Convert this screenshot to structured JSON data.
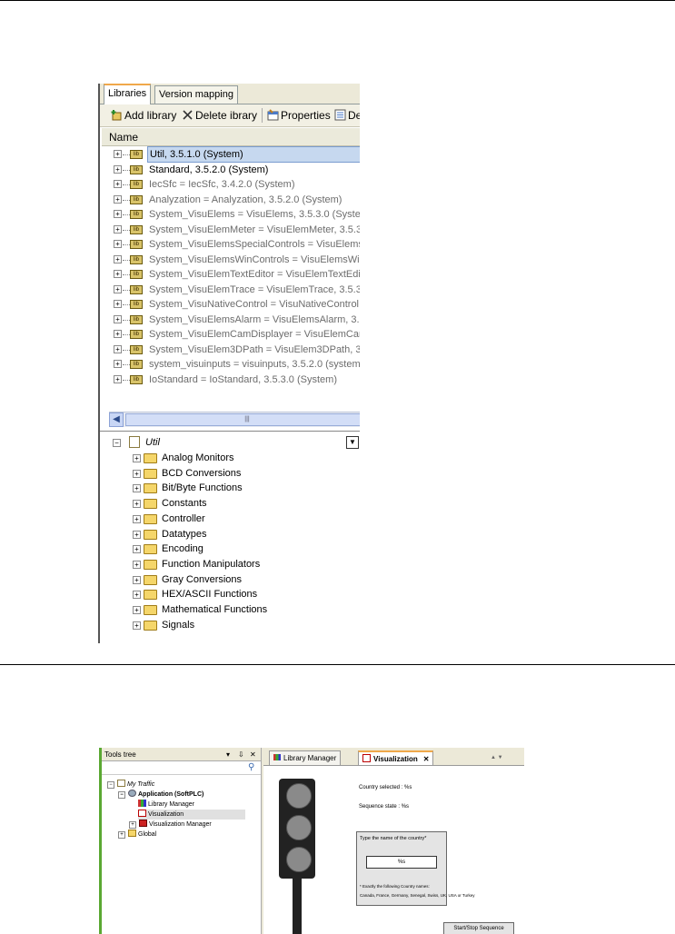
{
  "library_manager": {
    "tabs": [
      "Libraries",
      "Version mapping"
    ],
    "toolbar": {
      "add_library": "Add library",
      "delete_library": "Delete ibrary",
      "properties": "Properties",
      "details": "De"
    },
    "column_header": "Name",
    "libraries": [
      "Util, 3.5.1.0 (System)",
      "Standard, 3.5.2.0 (System)",
      "IecSfc = IecSfc, 3.4.2.0 (System)",
      "Analyzation = Analyzation, 3.5.2.0 (System)",
      "System_VisuElems = VisuElems, 3.5.3.0 (System",
      "System_VisuElemMeter = VisuElemMeter, 3.5.3.0",
      "System_VisuElemsSpecialControls = VisuElemsSp",
      "System_VisuElemsWinControls = VisuElemsWinC",
      "System_VisuElemTextEditor = VisuElemTextEdito",
      "System_VisuElemTrace = VisuElemTrace, 3.5.3.0",
      "System_VisuNativeControl = VisuNativeControl, 3",
      "System_VisuElemsAlarm = VisuElemsAlarm, 3.5.3",
      "System_VisuElemCamDisplayer = VisuElemCamDi",
      "System_VisuElem3DPath = VisuElem3DPath, 3.5.",
      "system_visuinputs = visuinputs, 3.5.2.0 (system",
      "IoStandard = IoStandard, 3.5.3.0 (System)"
    ],
    "content_root": "Util",
    "categories": [
      "Analog Monitors",
      "BCD Conversions",
      "Bit/Byte Functions",
      "Constants",
      "Controller",
      "Datatypes",
      "Encoding",
      "Function Manipulators",
      "Gray Conversions",
      "HEX/ASCII Functions",
      "Mathematical Functions",
      "Signals"
    ]
  },
  "visualization": {
    "tools_tree": {
      "title": "Tools tree",
      "pin": "⇩",
      "close": "✕",
      "project": "My Traffic",
      "application": "Application (SoftPLC)",
      "library_manager": "Library Manager",
      "visualization": "Visualization",
      "visualization_manager": "Visualization Manager",
      "global": "Global"
    },
    "editor_tabs": [
      "Library Manager",
      "Visualization"
    ],
    "canvas": {
      "country_selected": "Country selected :  %s",
      "sequence_state": "Sequence state :  %s",
      "prompt": "Type the name of the country*",
      "field_value": "%s",
      "footnote": "* Exactly the following Country names:",
      "countries": "Canada, France, Germany, Senegal, Swiss, UK, USA or Turkey",
      "button": "Start/Stop Sequence"
    }
  }
}
